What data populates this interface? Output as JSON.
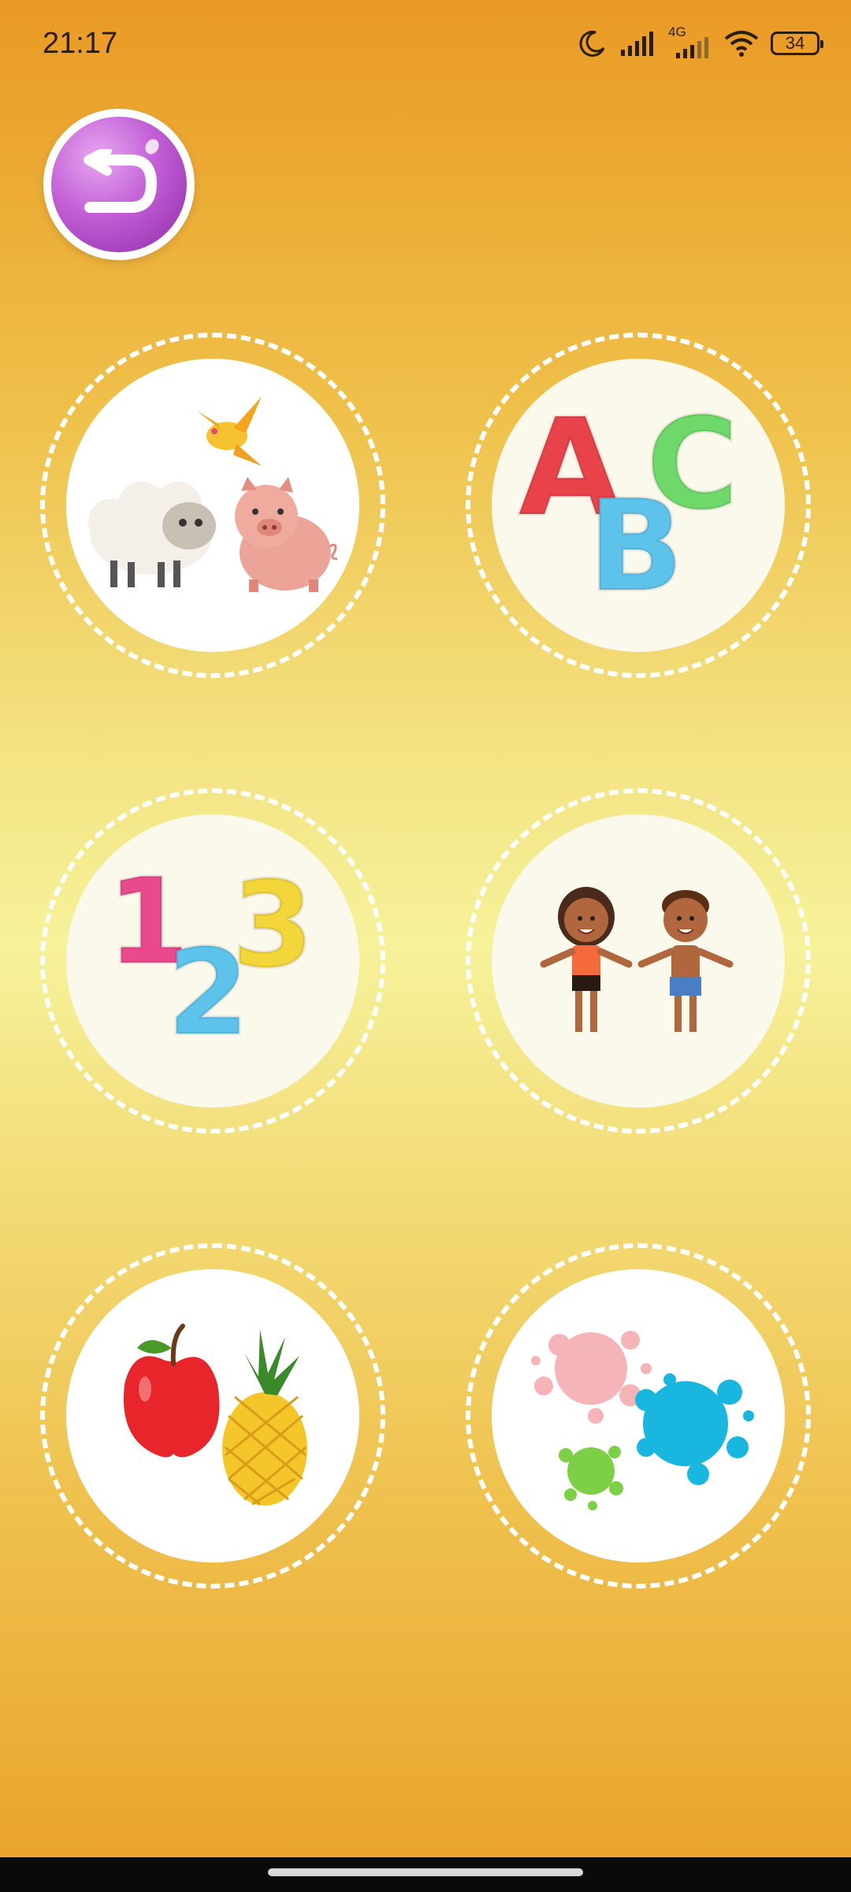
{
  "status_bar": {
    "time": "21:17",
    "network_label": "4G",
    "battery_level": "34",
    "icons": [
      "moon-icon",
      "signal-icon",
      "signal-4g-icon",
      "wifi-icon",
      "battery-icon"
    ]
  },
  "back_button": {
    "icon": "back-arrow-icon",
    "color": "#b548cf"
  },
  "categories": [
    {
      "name": "animals",
      "icon": "animals-icon"
    },
    {
      "name": "abc",
      "letters": [
        "A",
        "B",
        "C"
      ]
    },
    {
      "name": "numbers",
      "digits": [
        "1",
        "2",
        "3"
      ]
    },
    {
      "name": "body",
      "icon": "kids-icon"
    },
    {
      "name": "fruits",
      "icon": "fruits-icon"
    },
    {
      "name": "colors",
      "icon": "paint-splash-icon"
    }
  ],
  "colors": {
    "letter_a": "#e8424a",
    "letter_b": "#5ec3ea",
    "letter_c": "#6fd86a",
    "digit_1": "#e94a8c",
    "digit_2": "#5ec3ea",
    "digit_3": "#f2d63a"
  }
}
